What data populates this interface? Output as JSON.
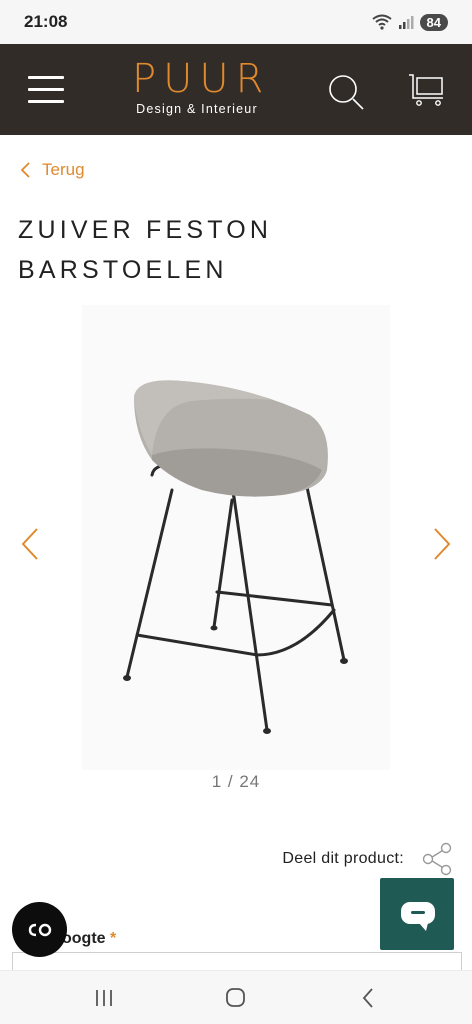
{
  "status_bar": {
    "time": "21:08",
    "battery": "84"
  },
  "header": {
    "logo_main": "PUUR",
    "logo_sub": "Design & Interieur",
    "accent_color": "#e08a2e",
    "background_color": "#322c28",
    "icons": [
      "menu-icon",
      "search-icon",
      "cart-icon"
    ]
  },
  "back_link": {
    "label": "Terug"
  },
  "product": {
    "title_line1": "ZUIVER FESTON",
    "title_line2": "BARSTOELEN"
  },
  "gallery": {
    "counter": "1 / 24",
    "image_alt": "bar-stool-photo"
  },
  "share": {
    "label": "Deel dit product:"
  },
  "options": {
    "height_label": "oogte",
    "required_mark": "*"
  },
  "floating_buttons": {
    "co_label": "CO",
    "chat_color": "#1f5a55"
  },
  "nav_bar": {
    "icons": [
      "recent-apps-icon",
      "home-icon",
      "back-icon"
    ]
  }
}
